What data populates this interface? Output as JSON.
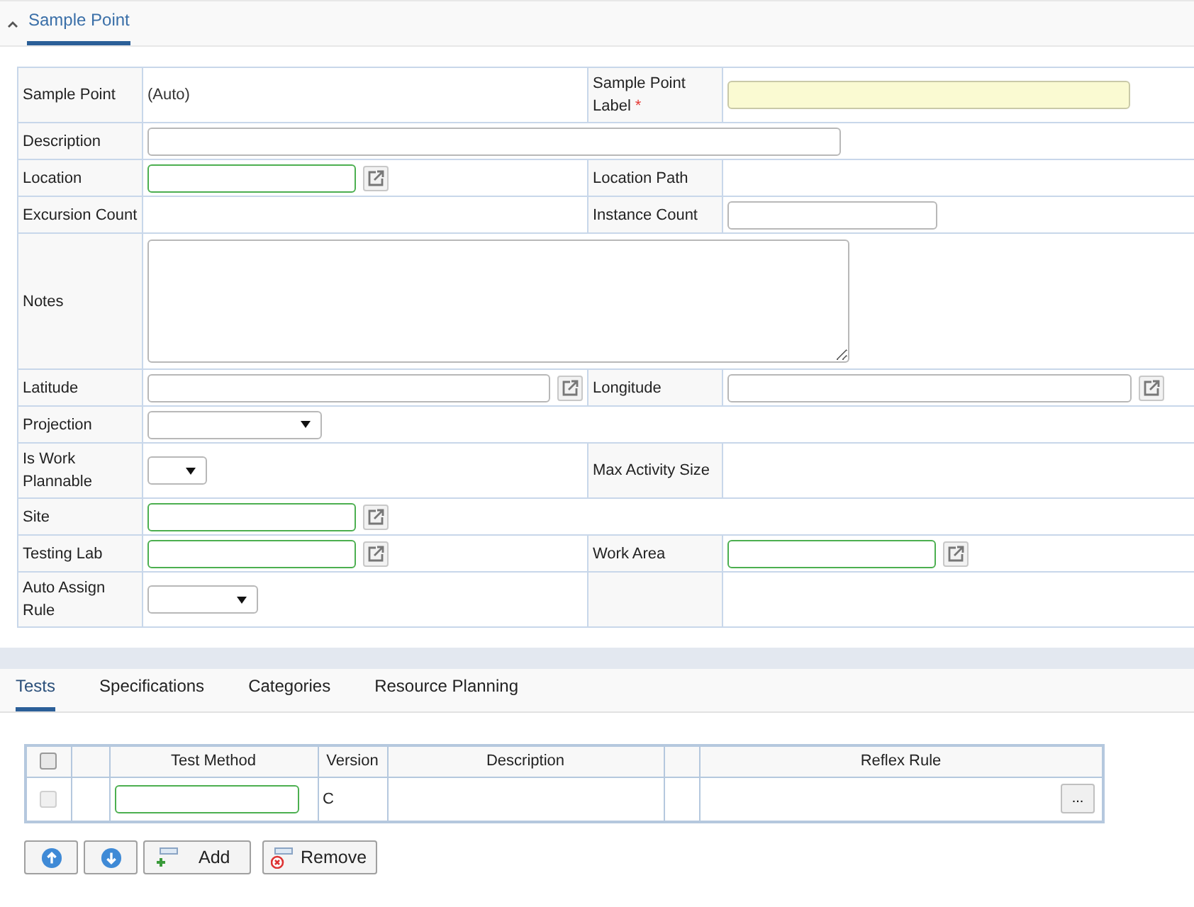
{
  "section": {
    "title": "Sample Point",
    "expanded": true,
    "selected": true
  },
  "form": {
    "required_mark": "*",
    "rows": [
      {
        "left": {
          "label": "Sample Point",
          "required": false,
          "field": {
            "kind": "static",
            "value": "(Auto)"
          }
        },
        "right": {
          "label": "Sample Point Label",
          "required": true,
          "field": {
            "kind": "input"
          }
        }
      },
      {
        "left": {
          "label": "Description",
          "required": false,
          "field": {
            "kind": "input"
          }
        }
      },
      {
        "left": {
          "label": "Location",
          "required": false,
          "field": {
            "kind": "lookup"
          }
        },
        "right": {
          "label": "Location Path",
          "required": false,
          "field": {
            "kind": "empty"
          }
        }
      },
      {
        "left": {
          "label": "Excursion Count",
          "required": false,
          "field": {
            "kind": "empty"
          }
        },
        "right": {
          "label": "Instance Count",
          "required": false,
          "field": {
            "kind": "input"
          }
        }
      },
      {
        "left": {
          "label": "Notes",
          "required": false,
          "field": {
            "kind": "textarea"
          }
        }
      },
      {
        "left": {
          "label": "Latitude",
          "required": false,
          "field": {
            "kind": "coordinate"
          }
        },
        "right": {
          "label": "Longitude",
          "required": false,
          "field": {
            "kind": "coordinate"
          }
        }
      },
      {
        "left": {
          "label": "Projection",
          "required": false,
          "field": {
            "kind": "select"
          }
        }
      },
      {
        "left": {
          "label": "Is Work Plannable",
          "required": false,
          "field": {
            "kind": "select"
          }
        },
        "right": {
          "label": "Max Activity Size",
          "required": false,
          "field": {
            "kind": "empty"
          }
        }
      },
      {
        "left": {
          "label": "Site",
          "required": false,
          "field": {
            "kind": "lookup"
          }
        }
      },
      {
        "left": {
          "label": "Testing Lab",
          "required": false,
          "field": {
            "kind": "lookup"
          }
        },
        "right": {
          "label": "Work Area",
          "required": false,
          "field": {
            "kind": "lookup"
          }
        }
      },
      {
        "left": {
          "label": "Auto Assign Rule",
          "required": false,
          "field": {
            "kind": "select"
          }
        },
        "right": {
          "field": {
            "kind": "empty"
          }
        }
      }
    ]
  },
  "tabs": [
    {
      "label": "Tests",
      "selected": true
    },
    {
      "label": "Specifications",
      "selected": false
    },
    {
      "label": "Categories",
      "selected": false
    },
    {
      "label": "Resource Planning",
      "selected": false
    }
  ],
  "tests_table": {
    "header_checked": false,
    "columns": [
      "Test Method",
      "Version",
      "Description",
      "Reflex Rule"
    ],
    "rows": [
      {
        "checked": false,
        "disabled": true,
        "version": "C",
        "reflex_button": "..."
      }
    ]
  },
  "buttons": [
    {
      "kind": "up"
    },
    {
      "kind": "down"
    },
    {
      "kind": "add",
      "label": "Add"
    },
    {
      "kind": "remove",
      "label": "Remove"
    }
  ]
}
